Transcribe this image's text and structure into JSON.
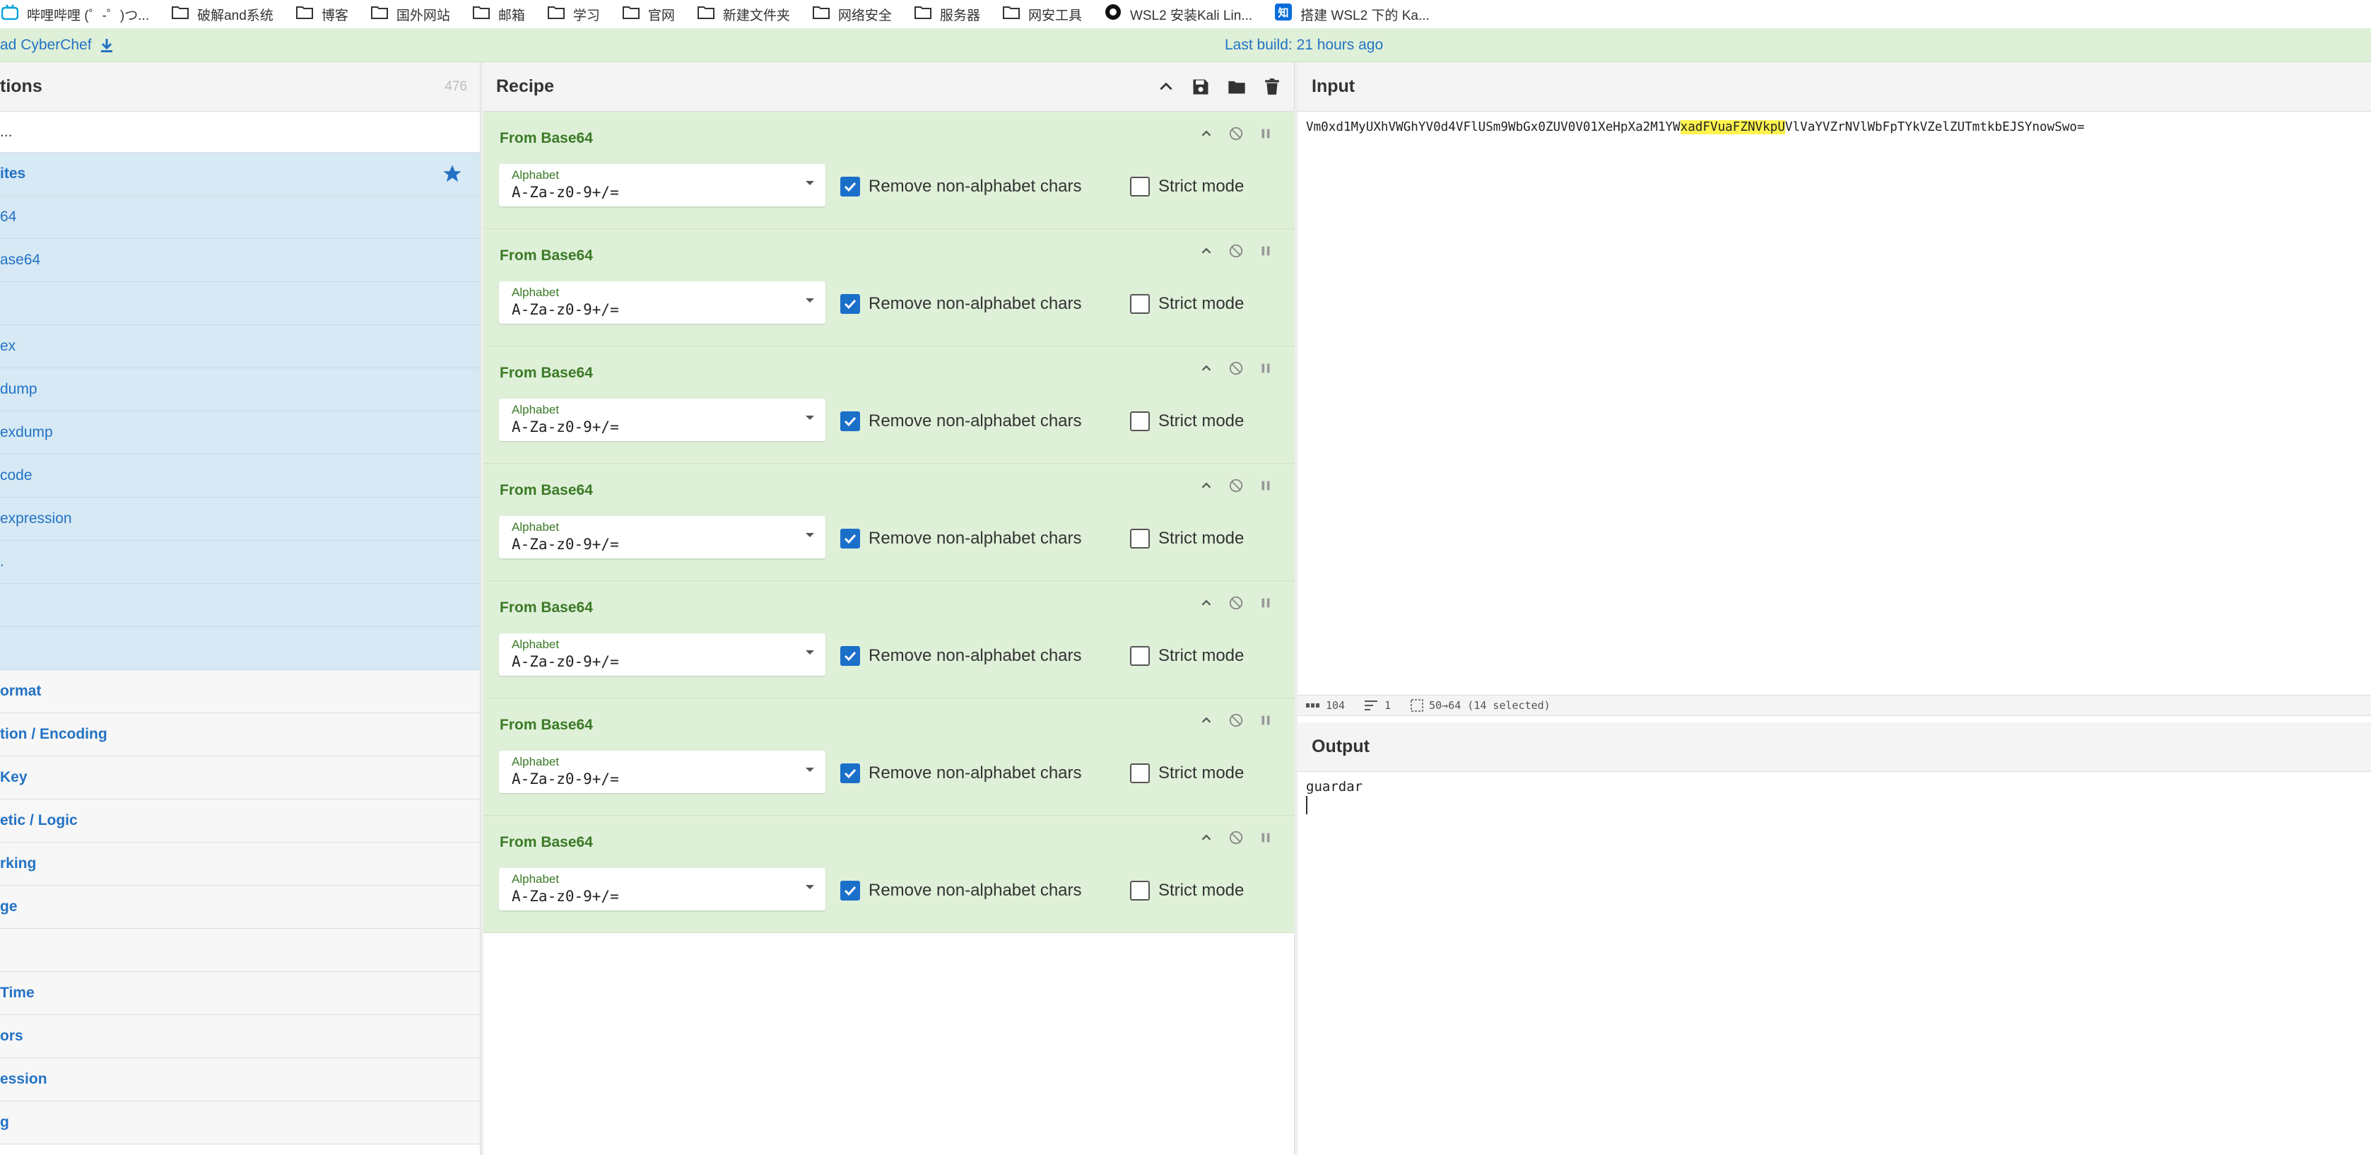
{
  "bookmarks": [
    {
      "label": "哔哩哔哩 (゜-゜)つ...",
      "icon": "bilibili-icon"
    },
    {
      "label": "破解and系统",
      "icon": "folder-icon"
    },
    {
      "label": "博客",
      "icon": "folder-icon"
    },
    {
      "label": "国外网站",
      "icon": "folder-icon"
    },
    {
      "label": "邮箱",
      "icon": "folder-icon"
    },
    {
      "label": "学习",
      "icon": "folder-icon"
    },
    {
      "label": "官网",
      "icon": "folder-icon"
    },
    {
      "label": "新建文件夹",
      "icon": "folder-icon"
    },
    {
      "label": "网络安全",
      "icon": "folder-icon"
    },
    {
      "label": "服务器",
      "icon": "folder-icon"
    },
    {
      "label": "网安工具",
      "icon": "folder-icon"
    },
    {
      "label": "WSL2 安装Kali Lin...",
      "icon": "github-icon"
    },
    {
      "label": "搭建 WSL2 下的 Ka...",
      "icon": "zhihu-icon"
    }
  ],
  "banner": {
    "download_label": "ad CyberChef",
    "build_label": "Last build: 21 hours ago",
    "accent": "#2372c4"
  },
  "operations": {
    "title": "tions",
    "count": "476",
    "search_text": "...",
    "favourites_label": "ites",
    "favourites": [
      "64",
      "ase64",
      "",
      "ex",
      "dump",
      "exdump",
      "code",
      " expression",
      ".",
      "",
      ""
    ],
    "categories": [
      "ormat",
      "tion / Encoding",
      "Key",
      "etic / Logic",
      "rking",
      "ge",
      "",
      "Time",
      "ors",
      "ession",
      "g"
    ]
  },
  "recipe": {
    "title": "Recipe",
    "steps": [
      {
        "name": "From Base64",
        "alphabet_label": "Alphabet",
        "alphabet": "A-Za-z0-9+/=",
        "remove_label": "Remove non-alphabet chars",
        "remove_checked": true,
        "strict_label": "Strict mode",
        "strict_checked": false
      },
      {
        "name": "From Base64",
        "alphabet_label": "Alphabet",
        "alphabet": "A-Za-z0-9+/=",
        "remove_label": "Remove non-alphabet chars",
        "remove_checked": true,
        "strict_label": "Strict mode",
        "strict_checked": false
      },
      {
        "name": "From Base64",
        "alphabet_label": "Alphabet",
        "alphabet": "A-Za-z0-9+/=",
        "remove_label": "Remove non-alphabet chars",
        "remove_checked": true,
        "strict_label": "Strict mode",
        "strict_checked": false
      },
      {
        "name": "From Base64",
        "alphabet_label": "Alphabet",
        "alphabet": "A-Za-z0-9+/=",
        "remove_label": "Remove non-alphabet chars",
        "remove_checked": true,
        "strict_label": "Strict mode",
        "strict_checked": false
      },
      {
        "name": "From Base64",
        "alphabet_label": "Alphabet",
        "alphabet": "A-Za-z0-9+/=",
        "remove_label": "Remove non-alphabet chars",
        "remove_checked": true,
        "strict_label": "Strict mode",
        "strict_checked": false
      },
      {
        "name": "From Base64",
        "alphabet_label": "Alphabet",
        "alphabet": "A-Za-z0-9+/=",
        "remove_label": "Remove non-alphabet chars",
        "remove_checked": true,
        "strict_label": "Strict mode",
        "strict_checked": false
      },
      {
        "name": "From Base64",
        "alphabet_label": "Alphabet",
        "alphabet": "A-Za-z0-9+/=",
        "remove_label": "Remove non-alphabet chars",
        "remove_checked": true,
        "strict_label": "Strict mode",
        "strict_checked": false
      }
    ]
  },
  "input": {
    "title": "Input",
    "text_before": "Vm0xd1MyUXhVWGhYV0d4VFlUSm9WbGx0ZUV0V01XeHpXa2M1YW",
    "text_selected": "xadFVuaFZNVkpU",
    "text_after": "VlVaYVZrNVlWbFpTYkVZelZUTmtkbEJSYnowSwo="
  },
  "status": {
    "length_label": "104",
    "lines_label": "1",
    "selection_label": "50→64 (14 selected)"
  },
  "output": {
    "title": "Output",
    "text": "guardar"
  }
}
